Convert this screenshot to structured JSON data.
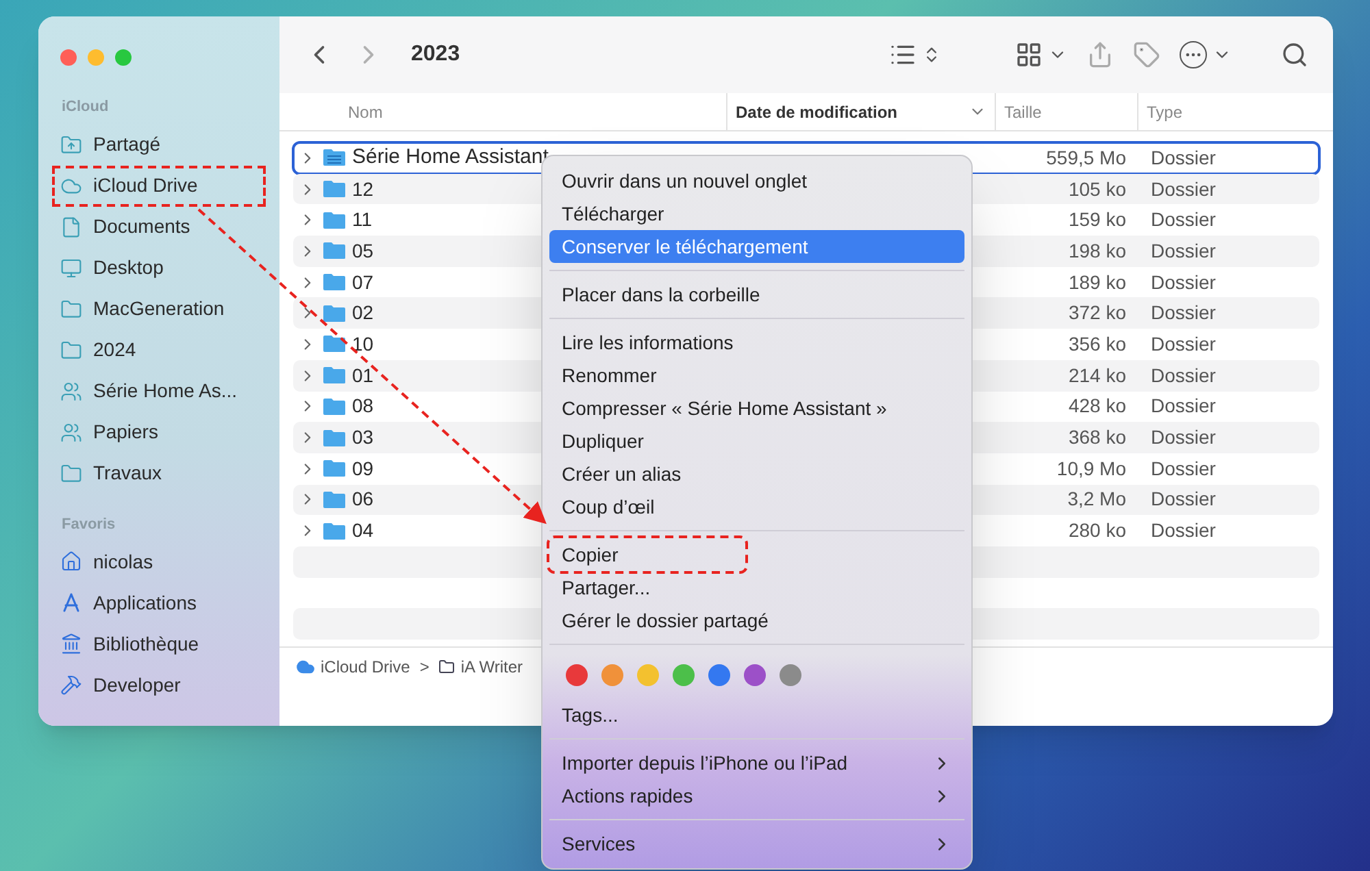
{
  "window": {
    "title": "2023"
  },
  "sidebar": {
    "sections": [
      {
        "heading": "iCloud",
        "items": [
          {
            "label": "Partagé",
            "kind": "shared-folder",
            "highlighted": false
          },
          {
            "label": "iCloud Drive",
            "kind": "cloud",
            "highlighted": true
          },
          {
            "label": "Documents",
            "kind": "document",
            "highlighted": false
          },
          {
            "label": "Desktop",
            "kind": "desktop",
            "highlighted": false
          },
          {
            "label": "MacGeneration",
            "kind": "folder",
            "highlighted": false
          },
          {
            "label": "2024",
            "kind": "folder",
            "highlighted": false
          },
          {
            "label": "Série Home As...",
            "kind": "group",
            "highlighted": false
          },
          {
            "label": "Papiers",
            "kind": "group",
            "highlighted": false
          },
          {
            "label": "Travaux",
            "kind": "folder",
            "highlighted": false
          }
        ]
      },
      {
        "heading": "Favoris",
        "items": [
          {
            "label": "nicolas",
            "kind": "home",
            "highlighted": false
          },
          {
            "label": "Applications",
            "kind": "apps",
            "highlighted": false
          },
          {
            "label": "Bibliothèque",
            "kind": "library",
            "highlighted": false
          },
          {
            "label": "Developer",
            "kind": "tools",
            "highlighted": false
          }
        ]
      }
    ]
  },
  "table": {
    "columns": [
      {
        "label": "Nom",
        "sorted": false
      },
      {
        "label": "Date de modification",
        "sorted": true
      },
      {
        "label": "Taille",
        "sorted": false
      },
      {
        "label": "Type",
        "sorted": false
      }
    ],
    "rows": [
      {
        "name": "Série Home Assistant",
        "size": "559,5 Mo",
        "type": "Dossier",
        "selected": true,
        "shared": true
      },
      {
        "name": "12",
        "size": "105 ko",
        "type": "Dossier",
        "selected": false,
        "shared": false
      },
      {
        "name": "11",
        "size": "159 ko",
        "type": "Dossier",
        "selected": false,
        "shared": false
      },
      {
        "name": "05",
        "size": "198 ko",
        "type": "Dossier",
        "selected": false,
        "shared": false
      },
      {
        "name": "07",
        "size": "189 ko",
        "type": "Dossier",
        "selected": false,
        "shared": false
      },
      {
        "name": "02",
        "size": "372 ko",
        "type": "Dossier",
        "selected": false,
        "shared": false
      },
      {
        "name": "10",
        "size": "356 ko",
        "type": "Dossier",
        "selected": false,
        "shared": false
      },
      {
        "name": "01",
        "size": "214 ko",
        "type": "Dossier",
        "selected": false,
        "shared": false
      },
      {
        "name": "08",
        "size": "428 ko",
        "type": "Dossier",
        "selected": false,
        "shared": false
      },
      {
        "name": "03",
        "size": "368 ko",
        "type": "Dossier",
        "selected": false,
        "shared": false
      },
      {
        "name": "09",
        "size": "10,9 Mo",
        "type": "Dossier",
        "selected": false,
        "shared": false
      },
      {
        "name": "06",
        "size": "3,2 Mo",
        "type": "Dossier",
        "selected": false,
        "shared": false
      },
      {
        "name": "04",
        "size": "280 ko",
        "type": "Dossier",
        "selected": false,
        "shared": false
      }
    ]
  },
  "path_bar": [
    {
      "label": "iCloud Drive",
      "separator": ">"
    },
    {
      "label": "iA Writer"
    }
  ],
  "context_menu": {
    "groups": [
      [
        {
          "kind": "item",
          "label": "Ouvrir dans un nouvel onglet",
          "selected": false,
          "submenu": false,
          "highlighted": false
        },
        {
          "kind": "item",
          "label": "Télécharger",
          "selected": false,
          "submenu": false,
          "highlighted": false
        },
        {
          "kind": "item",
          "label": "Conserver le téléchargement",
          "selected": true,
          "submenu": false,
          "highlighted": false
        }
      ],
      [
        {
          "kind": "item",
          "label": "Placer dans la corbeille",
          "selected": false,
          "submenu": false,
          "highlighted": false
        }
      ],
      [
        {
          "kind": "item",
          "label": "Lire les informations",
          "selected": false,
          "submenu": false,
          "highlighted": false
        },
        {
          "kind": "item",
          "label": "Renommer",
          "selected": false,
          "submenu": false,
          "highlighted": false
        },
        {
          "kind": "item",
          "label": "Compresser « Série Home Assistant »",
          "selected": false,
          "submenu": false,
          "highlighted": false
        },
        {
          "kind": "item",
          "label": "Dupliquer",
          "selected": false,
          "submenu": false,
          "highlighted": false
        },
        {
          "kind": "item",
          "label": "Créer un alias",
          "selected": false,
          "submenu": false,
          "highlighted": false
        },
        {
          "kind": "item",
          "label": "Coup d’œil",
          "selected": false,
          "submenu": false,
          "highlighted": false
        }
      ],
      [
        {
          "kind": "item",
          "label": "Copier",
          "selected": false,
          "submenu": false,
          "highlighted": true
        },
        {
          "kind": "item",
          "label": "Partager...",
          "selected": false,
          "submenu": false,
          "highlighted": false
        },
        {
          "kind": "item",
          "label": "Gérer le dossier partagé",
          "selected": false,
          "submenu": false,
          "highlighted": false
        }
      ],
      [
        {
          "kind": "tags",
          "colors": [
            {
              "color": "#e8393b"
            },
            {
              "color": "#f0913a"
            },
            {
              "color": "#f3c12f"
            },
            {
              "color": "#4cbf4a"
            },
            {
              "color": "#3478f0"
            },
            {
              "color": "#9c50c8"
            },
            {
              "color": "#8b8b8b"
            }
          ]
        },
        {
          "kind": "item",
          "label": "Tags...",
          "selected": false,
          "submenu": false,
          "highlighted": false
        }
      ],
      [
        {
          "kind": "item",
          "label": "Importer depuis l’iPhone ou l’iPad",
          "selected": false,
          "submenu": true,
          "highlighted": false
        },
        {
          "kind": "item",
          "label": "Actions rapides",
          "selected": false,
          "submenu": true,
          "highlighted": false
        }
      ],
      [
        {
          "kind": "item",
          "label": "Services",
          "selected": false,
          "submenu": true,
          "highlighted": false
        }
      ]
    ]
  }
}
